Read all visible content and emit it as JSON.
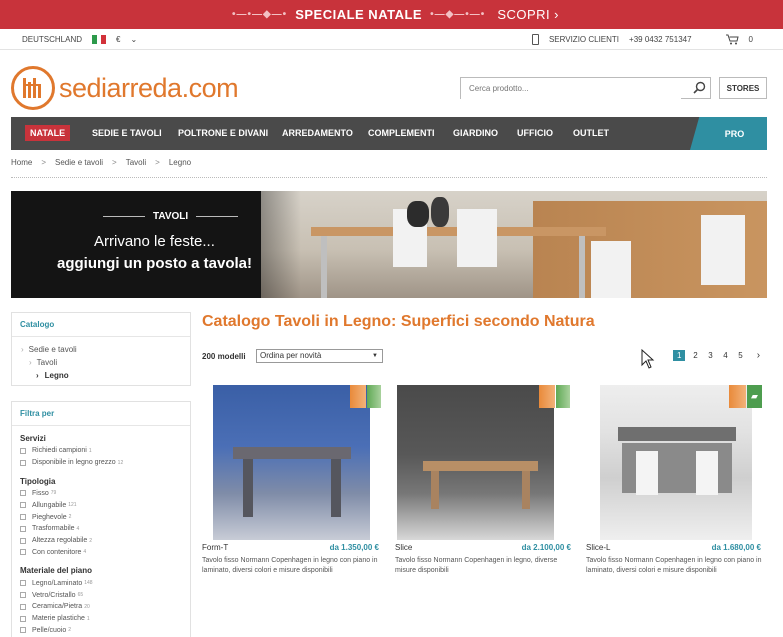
{
  "promo": {
    "title": "SPECIALE NATALE",
    "cta": "SCOPRI",
    "cta_arrow": "›",
    "deco_left": "•—•—◆—•",
    "deco_right": "•—◆—•—•"
  },
  "utility": {
    "country": "DEUTSCHLAND",
    "currency": "€",
    "currency_arrow": "⌄",
    "service_label": "SERVIZIO CLIENTI",
    "phone": "+39 0432 751347",
    "cart_count": "0"
  },
  "header": {
    "logo_text": "sediarreda.com",
    "search_placeholder": "Cerca prodotto...",
    "stores_label": "STORES"
  },
  "nav": {
    "highlight": "NATALE",
    "items": [
      "SEDIE E TAVOLI",
      "POLTRONE E DIVANI",
      "ARREDAMENTO",
      "COMPLEMENTI",
      "GIARDINO",
      "UFFICIO",
      "OUTLET"
    ],
    "pro": "PRO"
  },
  "breadcrumb": {
    "items": [
      "Home",
      "Sedie e tavoli",
      "Tavoli",
      "Legno"
    ],
    "separator": ">"
  },
  "banner": {
    "tag": "TAVOLI",
    "line1": "Arrivano le feste...",
    "line2": "aggiungi un posto a tavola!"
  },
  "sidebar": {
    "catalog_title": "Catalogo",
    "catalog_items": [
      "Sedie e tavoli",
      "Tavoli",
      "Legno"
    ],
    "filter_title": "Filtra per",
    "groups": [
      {
        "name": "Servizi",
        "options": [
          {
            "label": "Richiedi campioni",
            "count": "1"
          },
          {
            "label": "Disponibile in legno grezzo",
            "count": "12"
          }
        ]
      },
      {
        "name": "Tipologia",
        "options": [
          {
            "label": "Fisso",
            "count": "79"
          },
          {
            "label": "Allungabile",
            "count": "121"
          },
          {
            "label": "Pieghevole",
            "count": "2"
          },
          {
            "label": "Trasformabile",
            "count": "4"
          },
          {
            "label": "Altezza regolabile",
            "count": "2"
          },
          {
            "label": "Con contenitore",
            "count": "4"
          }
        ]
      },
      {
        "name": "Materiale del piano",
        "options": [
          {
            "label": "Legno/Laminato",
            "count": "148"
          },
          {
            "label": "Vetro/Cristallo",
            "count": "65"
          },
          {
            "label": "Ceramica/Pietra",
            "count": "20"
          },
          {
            "label": "Materie plastiche",
            "count": "1"
          },
          {
            "label": "Pelle/cuoio",
            "count": "2"
          }
        ]
      }
    ]
  },
  "listing": {
    "title": "Catalogo Tavoli in Legno: Superfici secondo Natura",
    "count": "200 modelli",
    "sort": "Ordina per novità",
    "pages": [
      "1",
      "2",
      "3",
      "4",
      "5"
    ],
    "next": "›"
  },
  "products": [
    {
      "name": "Form-T",
      "price": "da 1.350,00 €",
      "desc": "Tavolo fisso Normann Copenhagen in legno con piano in laminato, diversi colori e misure disponibili"
    },
    {
      "name": "Slice",
      "price": "da 2.100,00 €",
      "desc": "Tavolo fisso Normann Copenhagen in legno, diverse misure disponibili"
    },
    {
      "name": "Slice-L",
      "price": "da 1.680,00 €",
      "desc": "Tavolo fisso Normann Copenhagen in legno con piano in laminato, diversi colori e misure disponibili"
    }
  ],
  "colors": {
    "brand_orange": "#e0782d",
    "accent_teal": "#2f8fa2",
    "promo_red": "#c8333b",
    "nav_gray": "#4a4a4a"
  }
}
